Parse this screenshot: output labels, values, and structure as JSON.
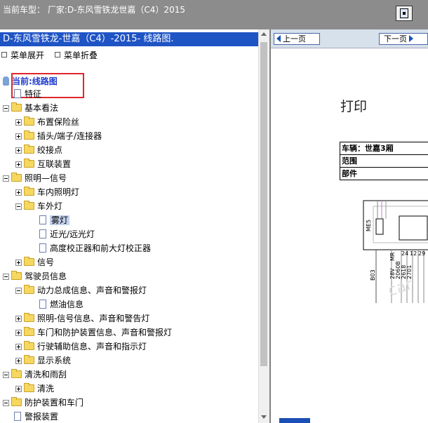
{
  "topbar": {
    "title": "当前车型：  厂家:D-东风雪铁龙世嘉（C4）2015"
  },
  "left": {
    "header": "D-东风雪铁龙-世嘉（C4）-2015- 线路图.",
    "expand_all": "菜单展开",
    "collapse_all": "菜单折叠",
    "current": "当前:线路图",
    "tree": [
      {
        "label": "特征",
        "type": "doc",
        "level": 1
      },
      {
        "label": "基本看法",
        "type": "folder",
        "open": true,
        "level": 0
      },
      {
        "label": "布置保险丝",
        "type": "folder",
        "open": false,
        "level": 1
      },
      {
        "label": "插头/端子/连接器",
        "type": "folder",
        "open": false,
        "level": 1
      },
      {
        "label": "绞接点",
        "type": "folder",
        "open": false,
        "level": 1
      },
      {
        "label": "互联装置",
        "type": "folder",
        "open": false,
        "level": 1
      },
      {
        "label": "照明—信号",
        "type": "folder",
        "open": true,
        "level": 0
      },
      {
        "label": "车内照明灯",
        "type": "folder",
        "open": false,
        "level": 1
      },
      {
        "label": "车外灯",
        "type": "folder",
        "open": true,
        "level": 1
      },
      {
        "label": "雾灯",
        "type": "doc",
        "level": 2,
        "selected": true
      },
      {
        "label": "近光/远光灯",
        "type": "doc",
        "level": 2
      },
      {
        "label": "高度校正器和前大灯校正器",
        "type": "doc",
        "level": 2
      },
      {
        "label": "信号",
        "type": "folder",
        "open": false,
        "level": 1
      },
      {
        "label": "驾驶员信息",
        "type": "folder",
        "open": true,
        "level": 0
      },
      {
        "label": "动力总成信息、声音和警报灯",
        "type": "folder",
        "open": true,
        "level": 1
      },
      {
        "label": "燃油信息",
        "type": "doc",
        "level": 2
      },
      {
        "label": "照明-信号信息、声音和警告灯",
        "type": "folder",
        "open": false,
        "level": 1
      },
      {
        "label": "车门和防护装置信息、声音和警报灯",
        "type": "folder",
        "open": false,
        "level": 1
      },
      {
        "label": "行驶辅助信息、声音和指示灯",
        "type": "folder",
        "open": false,
        "level": 1
      },
      {
        "label": "显示系统",
        "type": "folder",
        "open": false,
        "level": 1
      },
      {
        "label": "清洗和雨刮",
        "type": "folder",
        "open": true,
        "level": 0
      },
      {
        "label": "清洗",
        "type": "folder",
        "open": false,
        "level": 1
      },
      {
        "label": "防护装置和车门",
        "type": "folder",
        "open": true,
        "level": 0
      },
      {
        "label": "警报装置",
        "type": "doc",
        "level": 1
      }
    ]
  },
  "right": {
    "prev_label": "上一页",
    "next_label": "下一页",
    "print_label": "打印",
    "info_rows": [
      "车辆：世嘉3厢",
      "范围",
      "部件"
    ],
    "diagram_labels": [
      "ME5",
      "B03",
      "28V",
      "MR",
      "2060B",
      "2618",
      "2701",
      "24",
      "12",
      "29"
    ],
    "watermark": "car"
  },
  "colors": {
    "header_bg": "#1f54c5",
    "current_text": "#1f3ccf",
    "red_box": "#e0262c"
  }
}
